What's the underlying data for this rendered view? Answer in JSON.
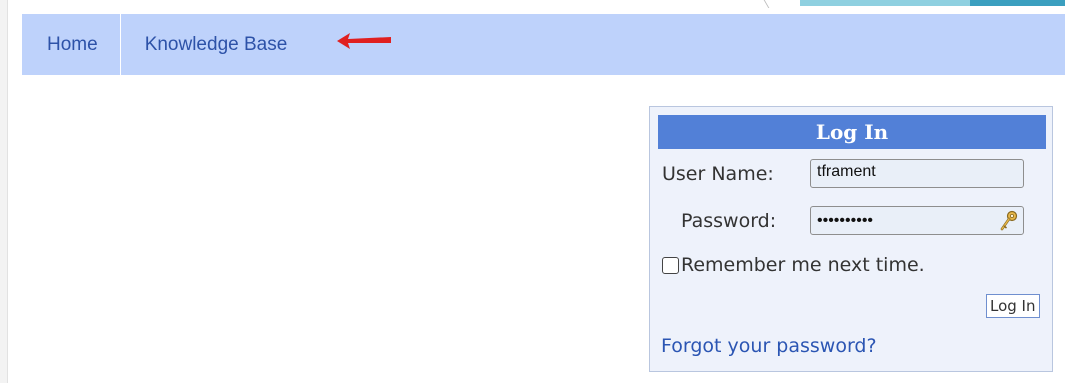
{
  "nav": {
    "home_label": "Home",
    "kb_label": "Knowledge Base"
  },
  "login": {
    "title": "Log In",
    "username_label": "User Name:",
    "username_value": "tframent",
    "password_label": "Password:",
    "password_value": "••••••••••",
    "remember_label": "Remember me next time.",
    "remember_checked": false,
    "button_label": "Log In",
    "forgot_label": "Forgot your password?"
  },
  "icons": {
    "key": "key-icon",
    "arrow": "red-arrow-icon"
  },
  "colors": {
    "nav_bg": "#bed2fb",
    "nav_text": "#2d52a8",
    "title_bar": "#5280d7",
    "box_bg": "#eef2fb",
    "link": "#2b55b3",
    "arrow": "#e02020"
  }
}
